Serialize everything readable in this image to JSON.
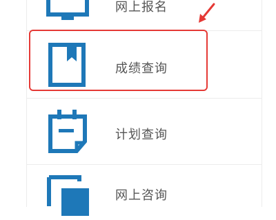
{
  "menu": {
    "items": [
      {
        "label": "网上报名",
        "icon": "monitor-icon"
      },
      {
        "label": "成绩查询",
        "icon": "bookmark-book-icon",
        "highlighted": true
      },
      {
        "label": "计划查询",
        "icon": "calendar-icon"
      },
      {
        "label": "网上咨询",
        "icon": "chat-window-icon"
      }
    ]
  },
  "colors": {
    "icon_blue": "#1e78b8",
    "highlight_red": "#e53935",
    "divider": "#ececec",
    "label": "#555555"
  }
}
